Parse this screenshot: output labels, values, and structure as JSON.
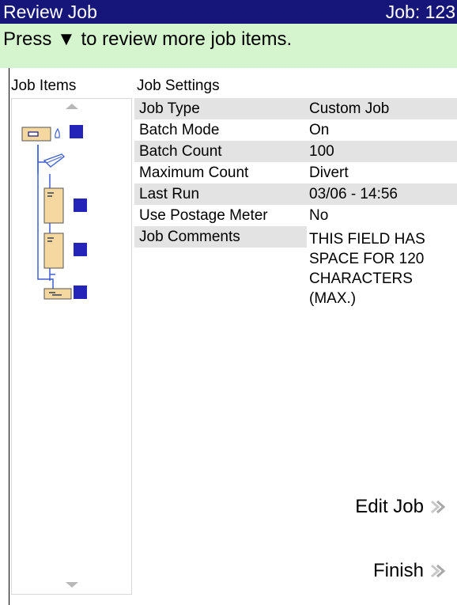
{
  "header": {
    "title": "Review Job",
    "job_number": "Job: 123"
  },
  "info": {
    "message": "Press ▼ to review more job items."
  },
  "panels": {
    "items_header": "Job Items",
    "settings_header": "Job Settings"
  },
  "settings": [
    {
      "label": "Job Type",
      "value": "Custom Job"
    },
    {
      "label": "Batch Mode",
      "value": "On"
    },
    {
      "label": "Batch Count",
      "value": "100"
    },
    {
      "label": "Maximum Count",
      "value": "Divert"
    },
    {
      "label": "Last Run",
      "value": "03/06 - 14:56"
    },
    {
      "label": "Use Postage Meter",
      "value": "No"
    }
  ],
  "comments": {
    "label": "Job Comments",
    "lines": [
      "THIS FIELD HAS",
      "SPACE FOR 120",
      "CHARACTERS",
      "(MAX.)"
    ]
  },
  "actions": {
    "edit": "Edit Job",
    "finish": "Finish"
  },
  "colors": {
    "title_bar": "#16167a",
    "info_bar": "#d4f5cd",
    "row_shade": "#e3e3e3",
    "tree_line": "#3f5fd0",
    "item_fill": "#f5d7a0",
    "item_square": "#2424b8"
  },
  "icons": [
    "scroll-up-icon",
    "envelope-icon",
    "seal-icon",
    "tray-icon",
    "sheet-icon",
    "insert-icon",
    "chevron-right-icon",
    "scroll-down-icon"
  ]
}
